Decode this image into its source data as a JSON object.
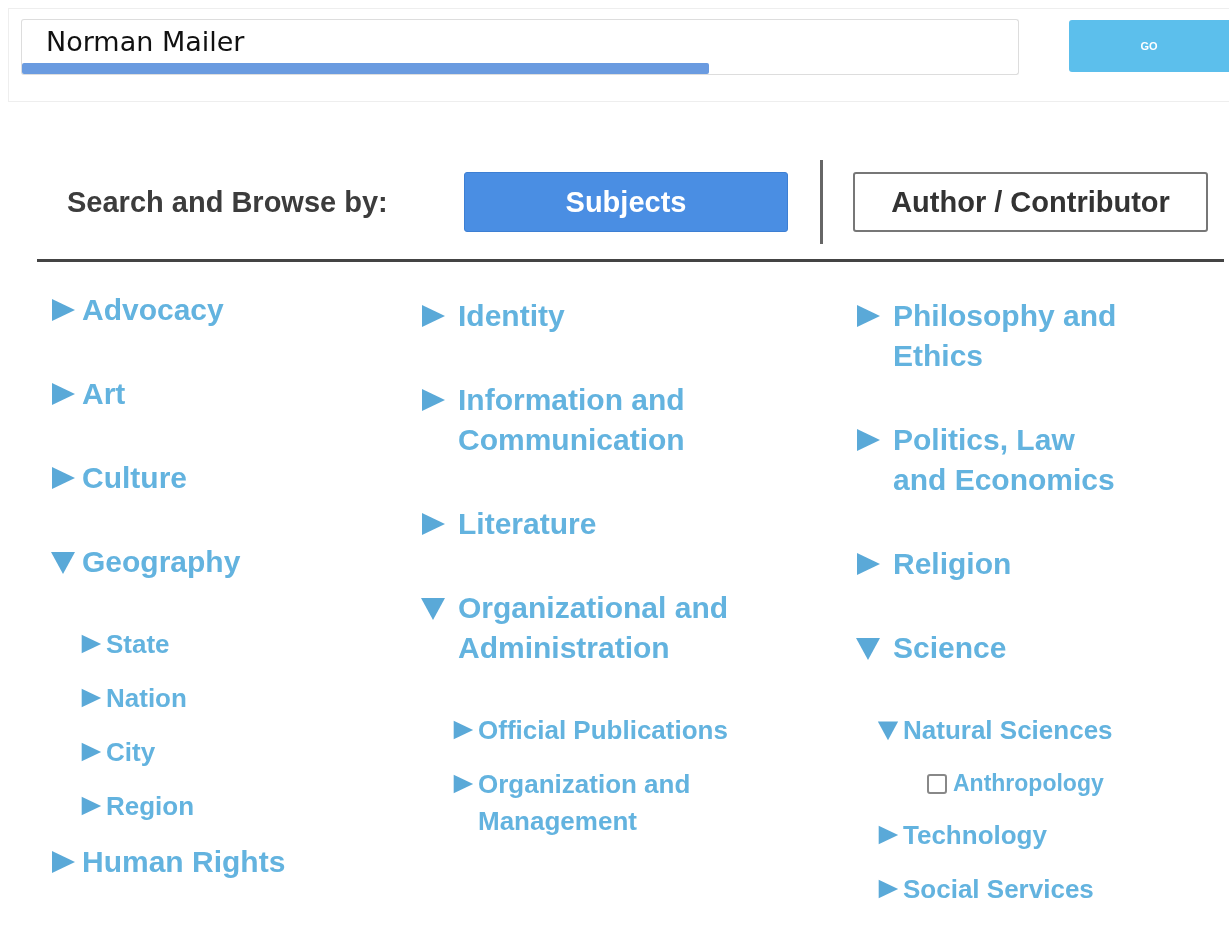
{
  "search": {
    "value": "Norman Mailer",
    "level": 0.69,
    "button": "GO"
  },
  "browse": {
    "label": "Search and Browse by:",
    "tabs": [
      {
        "label": "Subjects",
        "selected": true
      },
      {
        "label": "Author / Contributor",
        "selected": false
      }
    ]
  },
  "columns": [
    {
      "items": [
        {
          "kind": "branch",
          "label": "Advocacy",
          "expanded": false
        },
        {
          "kind": "branch",
          "label": "Art",
          "expanded": false
        },
        {
          "kind": "branch",
          "label": "Culture",
          "expanded": false
        },
        {
          "kind": "branch",
          "label": "Geography",
          "expanded": true,
          "children": [
            {
              "kind": "branch",
              "label": "State",
              "expanded": false
            },
            {
              "kind": "branch",
              "label": "Nation",
              "expanded": false
            },
            {
              "kind": "branch",
              "label": "City",
              "expanded": false
            },
            {
              "kind": "branch",
              "label": "Region",
              "expanded": false
            }
          ]
        },
        {
          "kind": "branch",
          "label": "Human Rights",
          "expanded": false
        }
      ]
    },
    {
      "items": [
        {
          "kind": "branch",
          "label": "Identity",
          "expanded": false
        },
        {
          "kind": "branch",
          "label": "Information and Communication",
          "expanded": false
        },
        {
          "kind": "branch",
          "label": "Literature",
          "expanded": false
        },
        {
          "kind": "branch",
          "label": "Organizational and Administration",
          "expanded": true,
          "children": [
            {
              "kind": "branch",
              "label": "Official Publications",
              "expanded": false
            },
            {
              "kind": "branch",
              "label": "Organization and Management",
              "expanded": false
            }
          ]
        }
      ]
    },
    {
      "items": [
        {
          "kind": "branch",
          "label": "Philosophy and Ethics",
          "expanded": false
        },
        {
          "kind": "branch",
          "label": "Politics, Law and Economics",
          "expanded": false
        },
        {
          "kind": "branch",
          "label": "Religion",
          "expanded": false
        },
        {
          "kind": "branch",
          "label": "Science",
          "expanded": true,
          "children": [
            {
              "kind": "branch",
              "label": "Natural Sciences",
              "expanded": true,
              "children": [
                {
                  "kind": "checkbox",
                  "label": "Anthropology",
                  "checked": false
                }
              ]
            },
            {
              "kind": "branch",
              "label": "Technology",
              "expanded": false
            },
            {
              "kind": "branch",
              "label": "Social Services",
              "expanded": false
            }
          ]
        }
      ]
    }
  ]
}
